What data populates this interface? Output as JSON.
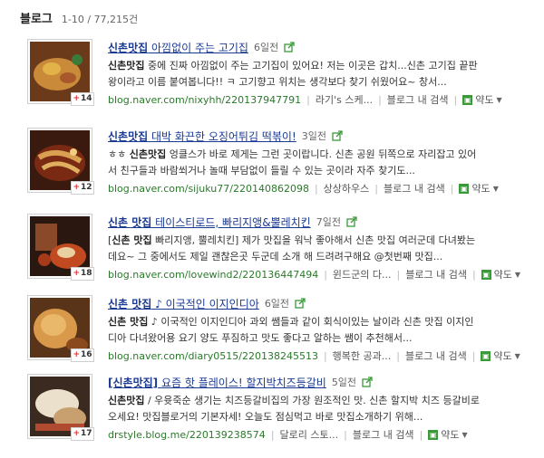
{
  "header": {
    "title": "블로그",
    "count": "1-10 / 77,215건"
  },
  "common": {
    "search_in_blog": "블로그 내 검색",
    "translate": "약도",
    "translate_icon": "map-icon"
  },
  "results": [
    {
      "title_bold": "신촌맛집",
      "title_rest": " 아낌없이 주는 고기집",
      "time": "6일전",
      "desc_line1_pre": "",
      "desc_line1_bold": "신촌맛집",
      "desc_line1_post": " 중에 진짜 아낌없이 주는 고기집이 있어요! 저는 이곳은 갑치...신촌 고기집 끝판",
      "desc_line2": "왕이라고 이름 붙여봅니다!! ㅋ 고기향고 위치는 생각보다 찾기 쉬웠어요~ 창서...",
      "url": "blog.naver.com/nixyhh/220137947791",
      "owner": "라기's 스케...",
      "likes": "14"
    },
    {
      "title_bold": "신촌맛집",
      "title_rest": " 대박 화끈한 오징어튀김 떡볶이!",
      "time": "3일전",
      "desc_line1_pre": "ㅎㅎ ",
      "desc_line1_bold": "신촌맛집",
      "desc_line1_post": " 엉클스가 바로 제게는 그런 곳이랍니다. 신촌 공원 뒤쪽으로 자리잡고 있어",
      "desc_line2": "서 친구들과 바람쐬거나 놀때 부담없이 들릴 수 있는 곳이라 자주 찾기도...",
      "url": "blog.naver.com/sijuku77/220140862098",
      "owner": "상상하우스",
      "likes": "12"
    },
    {
      "title_bold": "신촌 맛집",
      "title_rest": " 테이스티로드, 빠리지앵&뿔레치킨",
      "time": "7일전",
      "desc_line1_pre": "[",
      "desc_line1_bold": "신촌 맛집",
      "desc_line1_post": " 빠리지앵, 뿔레치킨] 제가 맛집을 워낙 좋아해서 신촌 맛집 여러군데 다녀봤는",
      "desc_line2": "데요~ 그 중에서도 제일 괜찮은곳 두군데 소개 해 드려려구해요 @첫번째 맛집...",
      "url": "blog.naver.com/lovewind2/220136447494",
      "owner": "윈드군의 다...",
      "likes": "18"
    },
    {
      "title_bold": "신촌 맛집",
      "title_rest": " ♪ 이국적인 이지인디아",
      "time": "6일전",
      "desc_line1_pre": "",
      "desc_line1_bold": "신촌 맛집",
      "desc_line1_post": " ♪ 이국적인 이지인디아 과외 쌤들과 같이 회식이있는 날이라 신촌 맛집 이지인",
      "desc_line2": "디아 다녀왔어용 요기 양도 푸짐하고 맛도 좋다고 알하는 쌤이 추천해서...",
      "url": "blog.naver.com/diary0515/220138245513",
      "owner": "행복한 공과...",
      "likes": "16"
    },
    {
      "title_bold": "[신촌맛집]",
      "title_rest": " 요즘 핫 플레이스! 할지박치즈등갈비",
      "time": "5일전",
      "desc_line1_pre": "",
      "desc_line1_bold": "신촌맛집",
      "desc_line1_post": " / 우윳죽순 생기는 치즈등갈비집의 가장 원조적인 맛. 신촌 할지박 치즈 등갈비로",
      "desc_line2": "오세요! 맛집블로거의 기본자세! 오늘도 점심먹고 바로 맛집소개하기 위해...",
      "url": "drstyle.blog.me/220139238574",
      "owner": "달로리 스토...",
      "likes": "17"
    }
  ],
  "colors": {
    "link": "#1a3a94",
    "url": "#2a7a2a",
    "badge_plus": "#dd3333",
    "translate_icon": "#3a9a3a"
  }
}
